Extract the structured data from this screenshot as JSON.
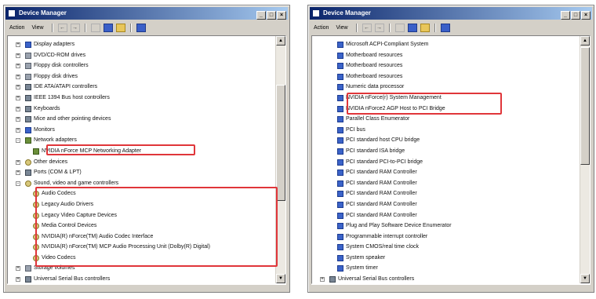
{
  "windows": [
    {
      "title": "Device Manager",
      "menu": [
        "Action",
        "View"
      ],
      "rows": [
        {
          "exp": "+",
          "indent": 0,
          "icon": "device",
          "label": "Display adapters"
        },
        {
          "exp": "+",
          "indent": 0,
          "icon": "disk",
          "label": "DVD/CD-ROM drives"
        },
        {
          "exp": "+",
          "indent": 0,
          "icon": "disk",
          "label": "Floppy disk controllers"
        },
        {
          "exp": "+",
          "indent": 0,
          "icon": "disk",
          "label": "Floppy disk drives"
        },
        {
          "exp": "+",
          "indent": 0,
          "icon": "generic",
          "label": "IDE ATA/ATAPI controllers"
        },
        {
          "exp": "+",
          "indent": 0,
          "icon": "generic",
          "label": "IEEE 1394 Bus host controllers"
        },
        {
          "exp": "+",
          "indent": 0,
          "icon": "generic",
          "label": "Keyboards"
        },
        {
          "exp": "+",
          "indent": 0,
          "icon": "generic",
          "label": "Mice and other pointing devices"
        },
        {
          "exp": "+",
          "indent": 0,
          "icon": "device",
          "label": "Monitors"
        },
        {
          "exp": "-",
          "indent": 0,
          "icon": "net",
          "label": "Network adapters"
        },
        {
          "exp": "",
          "indent": 1,
          "icon": "net",
          "label": "NVIDIA nForce MCP Networking Adapter"
        },
        {
          "exp": "+",
          "indent": 0,
          "icon": "speaker",
          "label": "Other devices"
        },
        {
          "exp": "+",
          "indent": 0,
          "icon": "generic",
          "label": "Ports (COM & LPT)"
        },
        {
          "exp": "-",
          "indent": 0,
          "icon": "speaker",
          "label": "Sound, video and game controllers"
        },
        {
          "exp": "",
          "indent": 1,
          "icon": "speaker",
          "label": "Audio Codecs"
        },
        {
          "exp": "",
          "indent": 1,
          "icon": "speaker",
          "label": "Legacy Audio Drivers"
        },
        {
          "exp": "",
          "indent": 1,
          "icon": "speaker",
          "label": "Legacy Video Capture Devices"
        },
        {
          "exp": "",
          "indent": 1,
          "icon": "speaker",
          "label": "Media Control Devices"
        },
        {
          "exp": "",
          "indent": 1,
          "icon": "speaker",
          "label": "NVIDIA(R) nForce(TM) Audio Codec Interface"
        },
        {
          "exp": "",
          "indent": 1,
          "icon": "speaker",
          "label": "NVIDIA(R) nForce(TM) MCP Audio Processing Unit (Dolby(R) Digital)"
        },
        {
          "exp": "",
          "indent": 1,
          "icon": "speaker",
          "label": "Video Codecs"
        },
        {
          "exp": "+",
          "indent": 0,
          "icon": "disk",
          "label": "Storage volumes"
        },
        {
          "exp": "+",
          "indent": 0,
          "icon": "generic",
          "label": "Universal Serial Bus controllers"
        }
      ]
    },
    {
      "title": "Device Manager",
      "menu": [
        "Action",
        "View"
      ],
      "rows": [
        {
          "exp": "",
          "indent": 1,
          "icon": "pc",
          "label": "Microsoft ACPI-Compliant System"
        },
        {
          "exp": "",
          "indent": 1,
          "icon": "pc",
          "label": "Motherboard resources"
        },
        {
          "exp": "",
          "indent": 1,
          "icon": "pc",
          "label": "Motherboard resources"
        },
        {
          "exp": "",
          "indent": 1,
          "icon": "pc",
          "label": "Motherboard resources"
        },
        {
          "exp": "",
          "indent": 1,
          "icon": "pc",
          "label": "Numeric data processor"
        },
        {
          "exp": "",
          "indent": 1,
          "icon": "pc",
          "label": "NVIDIA nForce(r) System Management"
        },
        {
          "exp": "",
          "indent": 1,
          "icon": "pc",
          "label": "NVIDIA nForce2 AGP Host to PCI Bridge"
        },
        {
          "exp": "",
          "indent": 1,
          "icon": "pc",
          "label": "Parallel Class Enumerator"
        },
        {
          "exp": "",
          "indent": 1,
          "icon": "pc",
          "label": "PCI bus"
        },
        {
          "exp": "",
          "indent": 1,
          "icon": "pc",
          "label": "PCI standard host CPU bridge"
        },
        {
          "exp": "",
          "indent": 1,
          "icon": "pc",
          "label": "PCI standard ISA bridge"
        },
        {
          "exp": "",
          "indent": 1,
          "icon": "pc",
          "label": "PCI standard PCI-to-PCI bridge"
        },
        {
          "exp": "",
          "indent": 1,
          "icon": "pc",
          "label": "PCI standard RAM Controller"
        },
        {
          "exp": "",
          "indent": 1,
          "icon": "pc",
          "label": "PCI standard RAM Controller"
        },
        {
          "exp": "",
          "indent": 1,
          "icon": "pc",
          "label": "PCI standard RAM Controller"
        },
        {
          "exp": "",
          "indent": 1,
          "icon": "pc",
          "label": "PCI standard RAM Controller"
        },
        {
          "exp": "",
          "indent": 1,
          "icon": "pc",
          "label": "PCI standard RAM Controller"
        },
        {
          "exp": "",
          "indent": 1,
          "icon": "pc",
          "label": "Plug and Play Software Device Enumerator"
        },
        {
          "exp": "",
          "indent": 1,
          "icon": "pc",
          "label": "Programmable interrupt controller"
        },
        {
          "exp": "",
          "indent": 1,
          "icon": "pc",
          "label": "System CMOS/real time clock"
        },
        {
          "exp": "",
          "indent": 1,
          "icon": "pc",
          "label": "System speaker"
        },
        {
          "exp": "",
          "indent": 1,
          "icon": "pc",
          "label": "System timer"
        },
        {
          "exp": "+",
          "indent": 0,
          "icon": "generic",
          "label": "Universal Serial Bus controllers"
        }
      ]
    }
  ],
  "icons": {
    "minimize": "minimize-icon",
    "maximize": "maximize-icon",
    "close": "close-icon"
  },
  "colors": {
    "titlebar": "#0a246a",
    "highlight": "#e0363a",
    "window_face": "#d4d0c8"
  }
}
